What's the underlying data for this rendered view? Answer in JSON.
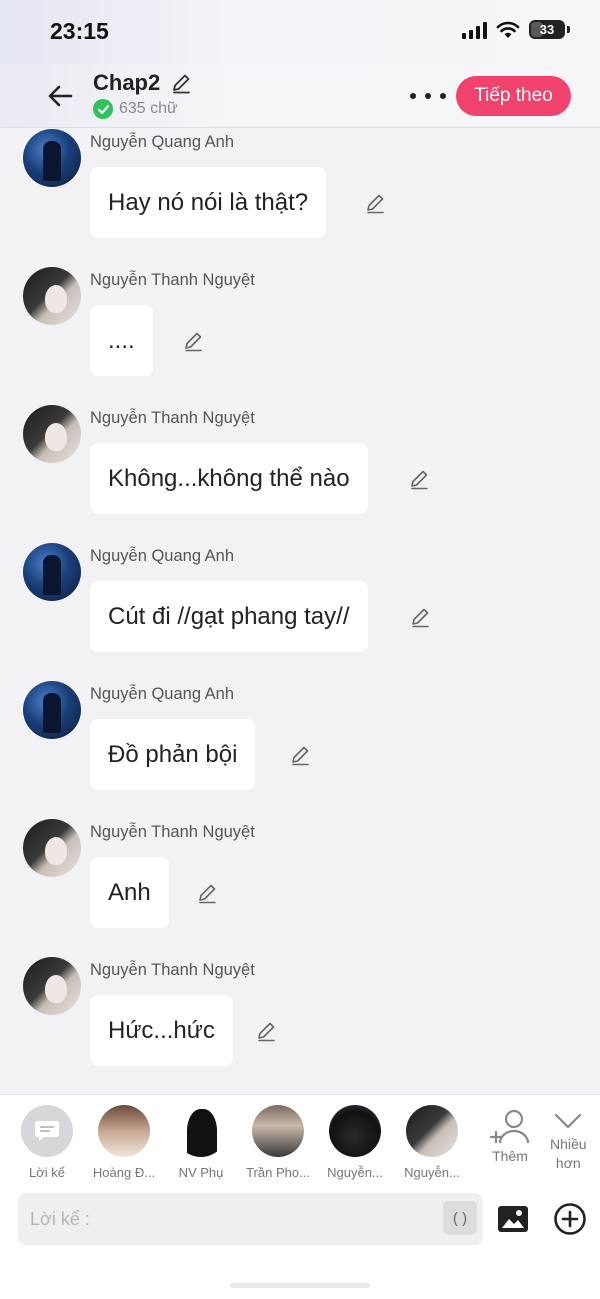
{
  "status": {
    "time": "23:15",
    "battery": "33",
    "icons": [
      "signal-icon",
      "wifi-icon",
      "battery-icon"
    ]
  },
  "header": {
    "title": "Chap2",
    "word_count": "635 chữ",
    "next_label": "Tiếp theo",
    "icons": [
      "back-arrow-icon",
      "pencil-icon",
      "check-icon",
      "more-icon"
    ]
  },
  "messages": [
    {
      "sender": "Nguyễn Quang Anh",
      "text": "Hay nó nói là thật?",
      "avatar": "blue"
    },
    {
      "sender": "Nguyễn Thanh Nguyệt",
      "text": "....",
      "avatar": "girl"
    },
    {
      "sender": "Nguyễn Thanh Nguyệt",
      "text": "Không...không thể nào",
      "avatar": "girl"
    },
    {
      "sender": "Nguyễn Quang Anh",
      "text": "Cút đi //gạt phang tay//",
      "avatar": "blue"
    },
    {
      "sender": "Nguyễn Quang Anh",
      "text": "Đồ phản bội",
      "avatar": "blue"
    },
    {
      "sender": "Nguyễn Thanh Nguyệt",
      "text": "Anh",
      "avatar": "girl"
    },
    {
      "sender": "Nguyễn Thanh Nguyệt",
      "text": "Hức...hức",
      "avatar": "girl"
    }
  ],
  "characters": [
    {
      "label": "Lời kể"
    },
    {
      "label": "Hoàng Đ..."
    },
    {
      "label": "NV Phụ"
    },
    {
      "label": "Trần Pho..."
    },
    {
      "label": "Nguyễn..."
    },
    {
      "label": "Nguyễn..."
    }
  ],
  "tools": {
    "add_label": "Thêm",
    "more_label_1": "Nhiều",
    "more_label_2": "hơn"
  },
  "composer": {
    "placeholder": "Lời kể :",
    "paren_label": "( )"
  },
  "colors": {
    "accent": "#f0426c",
    "verified": "#2fc25b",
    "background": "#f2f2f4"
  }
}
